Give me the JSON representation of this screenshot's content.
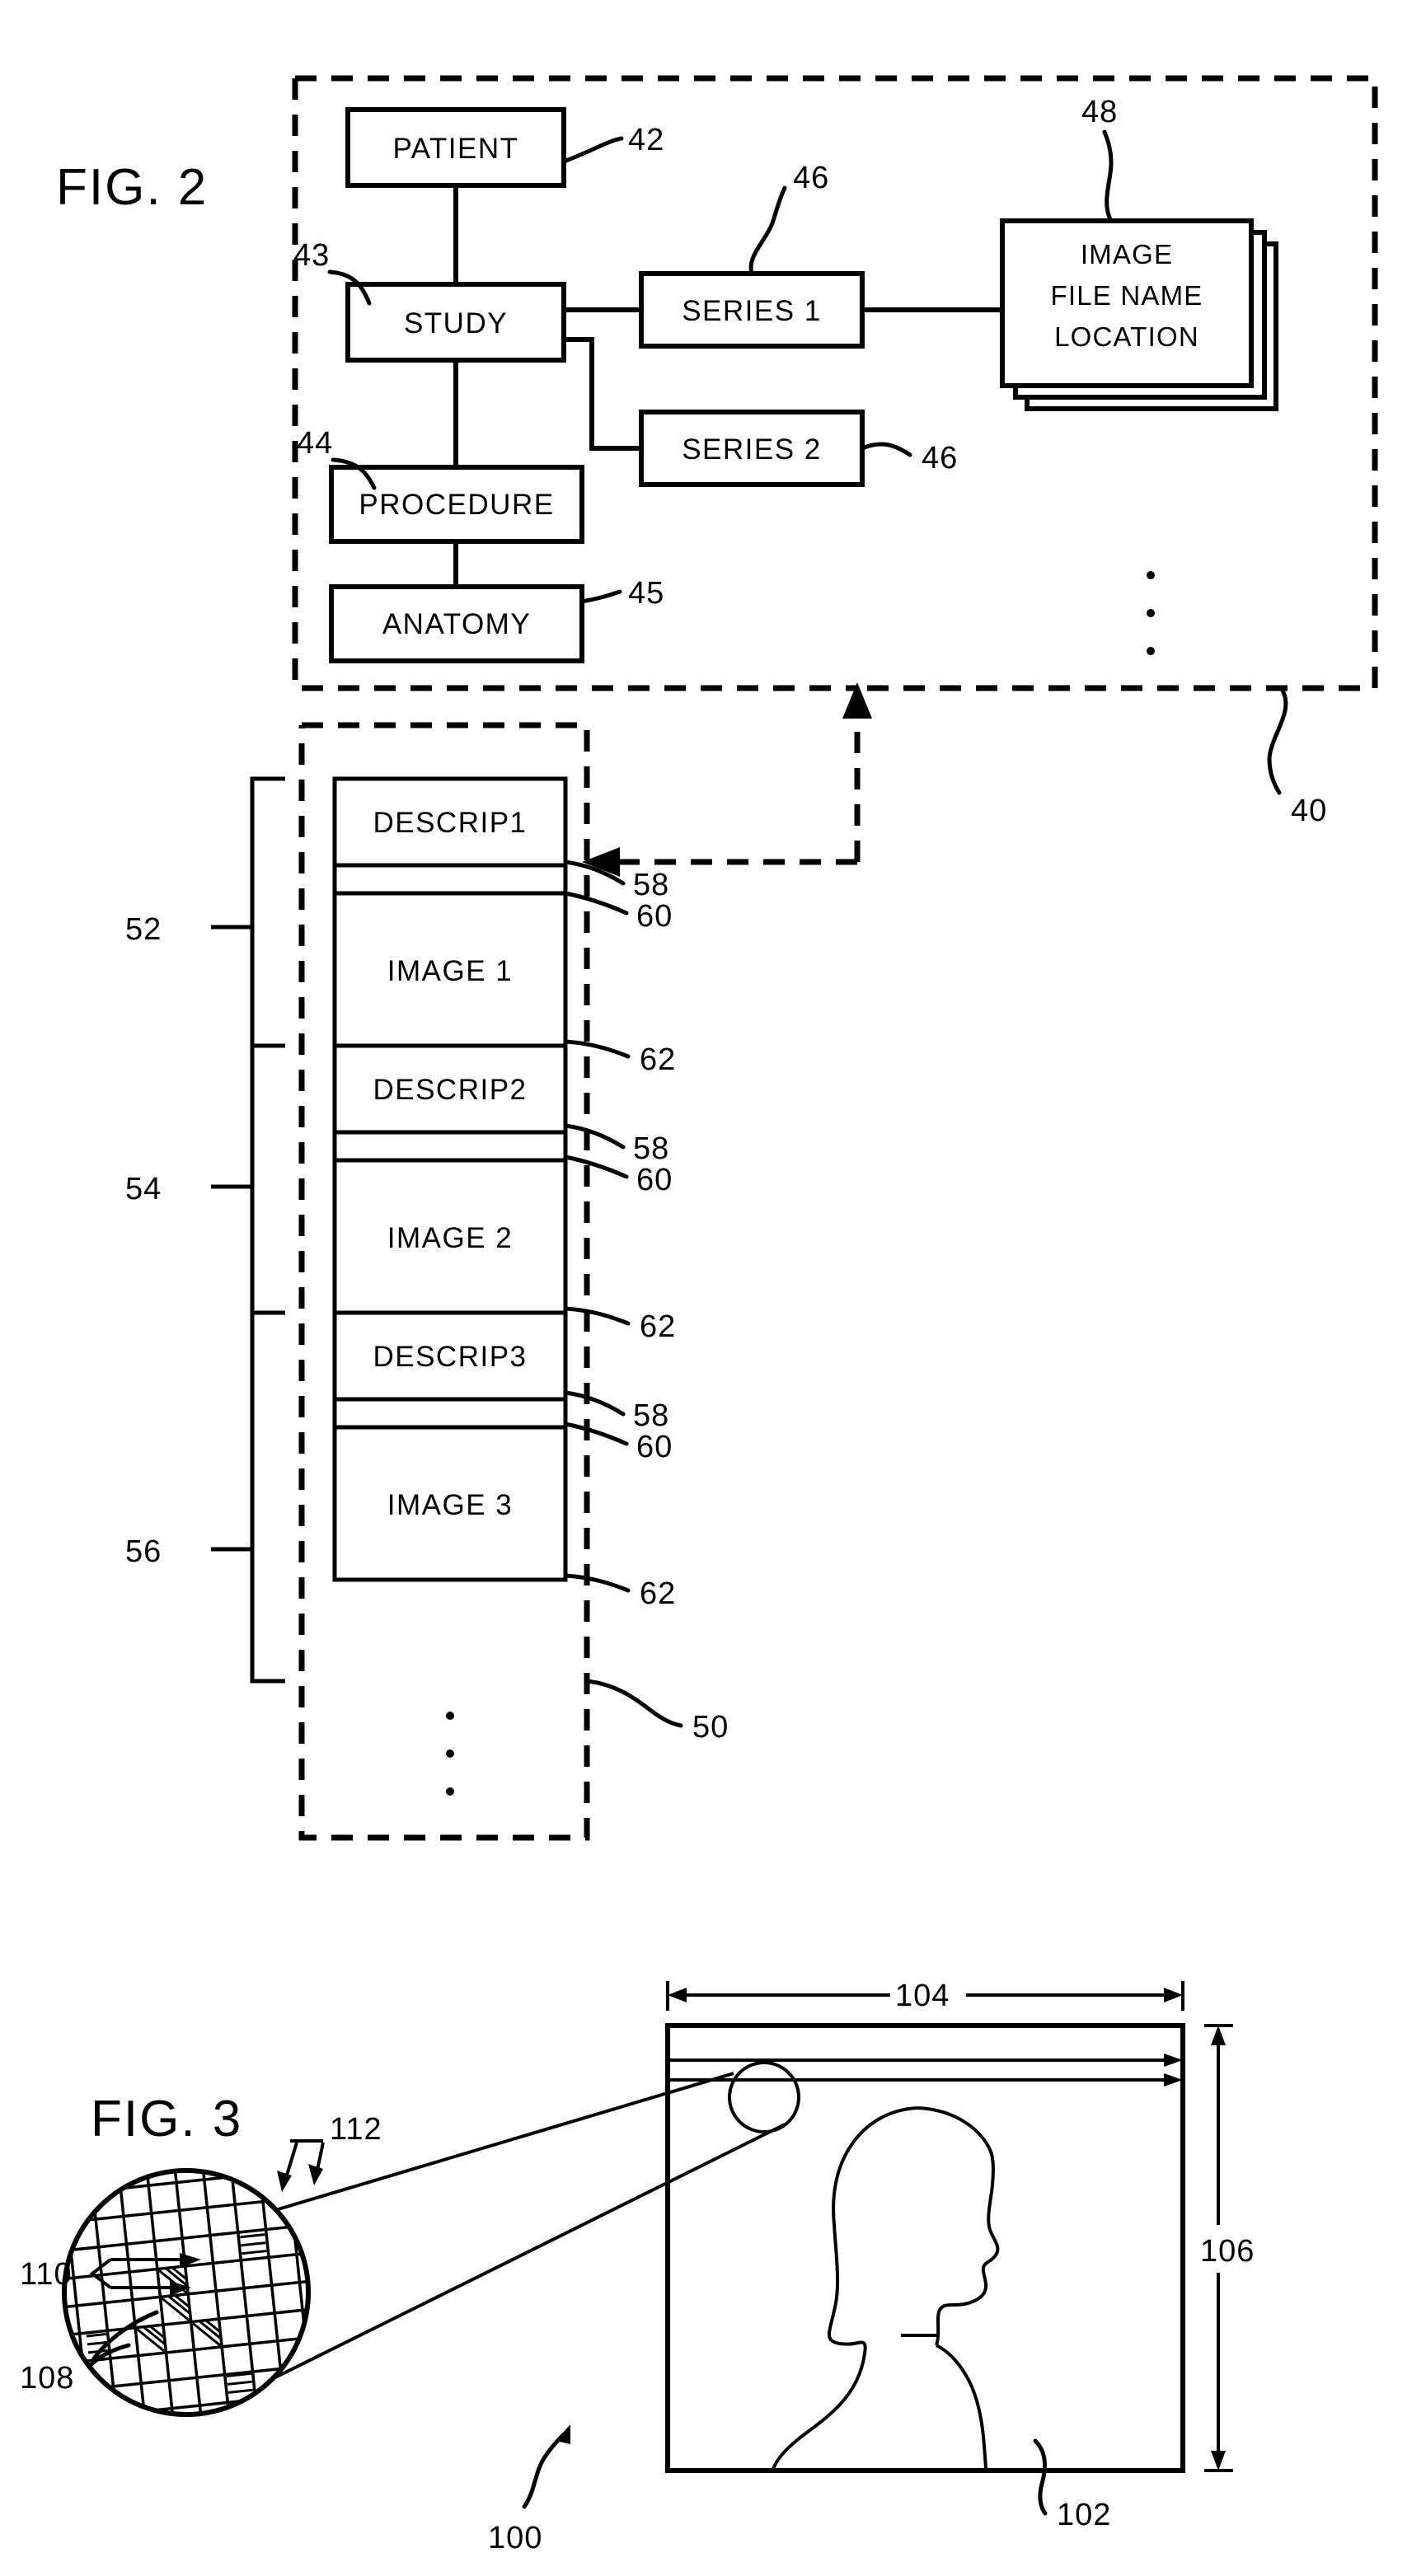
{
  "figures": [
    {
      "id": "fig2",
      "label": "FIG. 2",
      "database_ref": "40",
      "memory_ref": "50",
      "nodes": [
        {
          "name": "patient",
          "label": "PATIENT",
          "ref": "42"
        },
        {
          "name": "study",
          "label": "STUDY",
          "ref": "43"
        },
        {
          "name": "procedure",
          "label": "PROCEDURE",
          "ref": "44"
        },
        {
          "name": "anatomy",
          "label": "ANATOMY",
          "ref": "45"
        },
        {
          "name": "series-1",
          "label": "SERIES 1",
          "ref": "46"
        },
        {
          "name": "series-2",
          "label": "SERIES 2",
          "ref": "46"
        },
        {
          "name": "image-file",
          "label_line1": "IMAGE",
          "label_line2": "FILE  NAME",
          "label_line3": "LOCATION",
          "ref": "48"
        }
      ],
      "memory_groups": [
        {
          "ref": "52",
          "descriptor": "DESCRIP1",
          "image": "IMAGE 1",
          "descriptor_ref": "58",
          "separator_ref": "60",
          "image_ref": "62"
        },
        {
          "ref": "54",
          "descriptor": "DESCRIP2",
          "image": "IMAGE 2",
          "descriptor_ref": "58",
          "separator_ref": "60",
          "image_ref": "62"
        },
        {
          "ref": "56",
          "descriptor": "DESCRIP3",
          "image": "IMAGE 3",
          "descriptor_ref": "58",
          "separator_ref": "60",
          "image_ref": "62"
        }
      ]
    },
    {
      "id": "fig3",
      "label": "FIG. 3",
      "refs": {
        "image_frame": "102",
        "width_dim": "104",
        "height_dim": "106",
        "pixel": "108",
        "pixel_rows": "110",
        "magnified_edge": "112",
        "overall": "100"
      }
    }
  ]
}
